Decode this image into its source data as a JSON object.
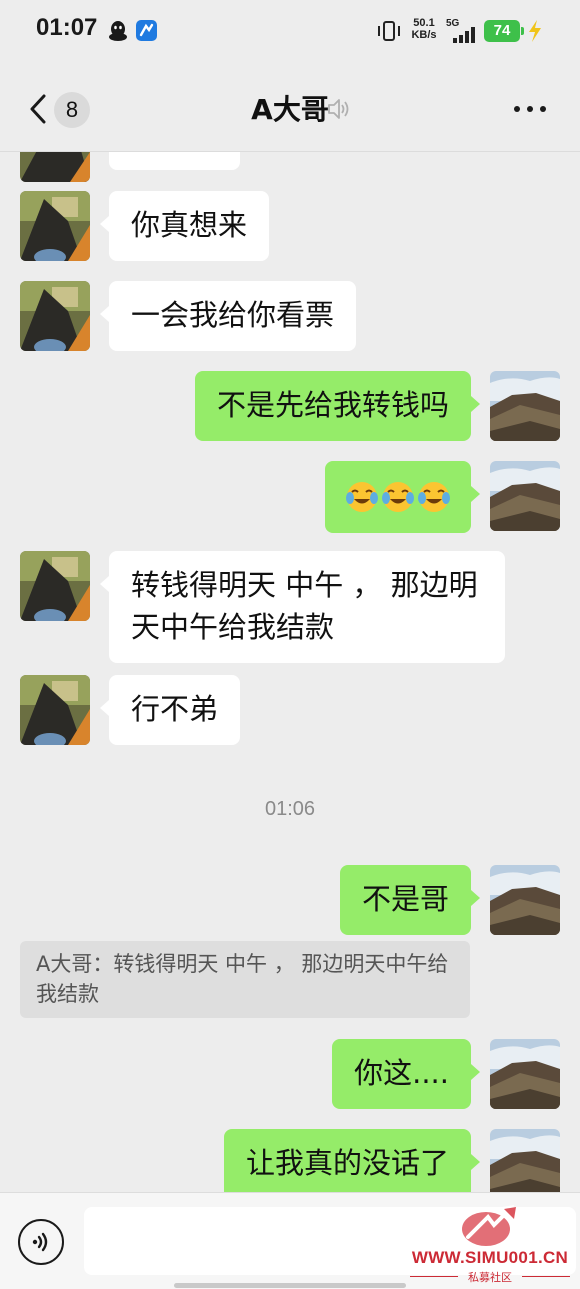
{
  "status_bar": {
    "time": "01:07",
    "net_speed_value": "50.1",
    "net_speed_unit": "KB/s",
    "network_type": "5G",
    "battery": "74",
    "icons": [
      "qq-icon",
      "app-icon",
      "vibrate-icon",
      "signal-icon",
      "battery-icon",
      "charging-icon"
    ]
  },
  "header": {
    "title": "A大哥",
    "unread_count": "8",
    "icons": [
      "back-chevron-icon",
      "voice-status-icon",
      "more-dots-icon"
    ]
  },
  "messages": [
    {
      "side": "left",
      "text": "你真想来"
    },
    {
      "side": "left",
      "text": "一会我给你看票"
    },
    {
      "side": "right",
      "text": "不是先给我转钱吗"
    },
    {
      "side": "right",
      "type": "emoji",
      "emoji": [
        "😂",
        "😂",
        "😂"
      ]
    },
    {
      "side": "left",
      "text": "转钱得明天 中午 ， 那边明天中午给我结款"
    },
    {
      "side": "left",
      "text": "行不弟"
    },
    {
      "type": "timestamp",
      "text": "01:06"
    },
    {
      "side": "right",
      "text": "不是哥"
    },
    {
      "type": "quote",
      "text": "A大哥：转钱得明天 中午 ， 那边明天中午给我结款"
    },
    {
      "side": "right",
      "text": "你这...."
    },
    {
      "side": "right",
      "text": "让我真的没话了"
    }
  ],
  "input_bar": {
    "icons": [
      "voice-input-icon"
    ],
    "message_text": ""
  },
  "watermark": {
    "site": "WWW.SIMU001.CN",
    "name": "私募社区"
  },
  "colors": {
    "background": "#ededed",
    "sent_bubble": "#95ec69",
    "received_bubble": "#ffffff",
    "battery": "#3ec04a",
    "watermark": "#cc2a35"
  }
}
